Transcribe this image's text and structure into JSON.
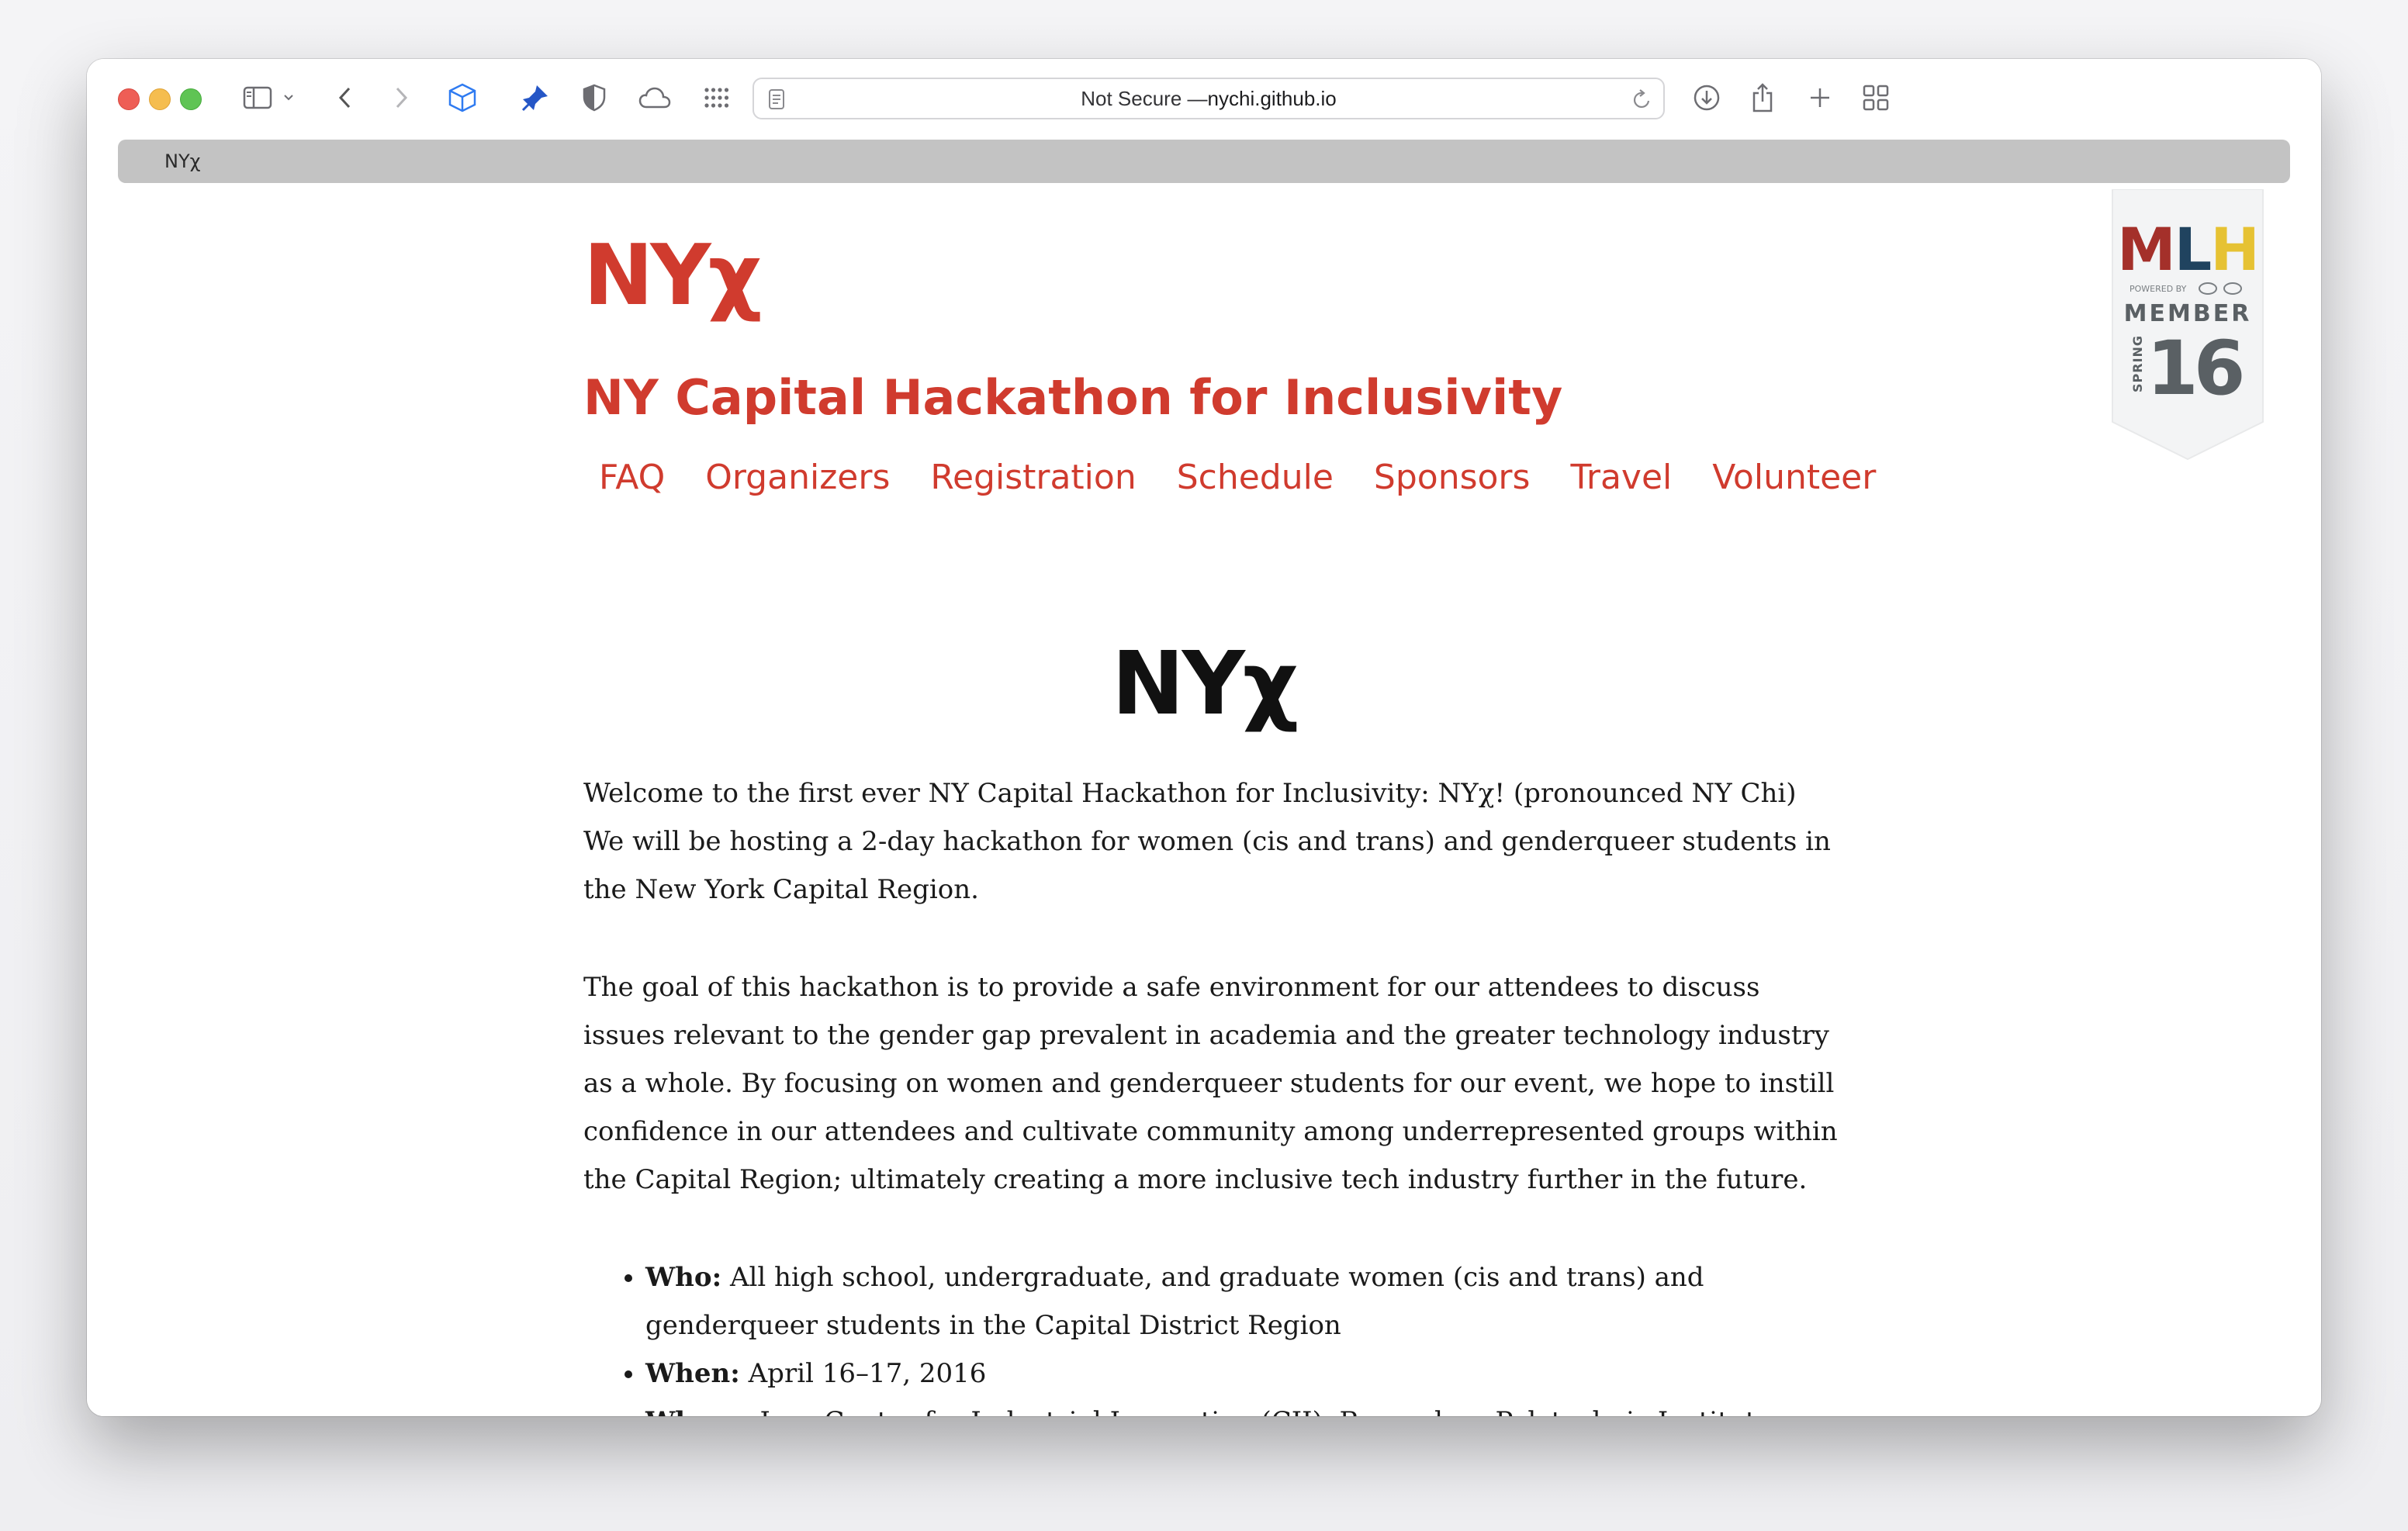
{
  "browser": {
    "address_prefix": "Not Secure — ",
    "address_host": "nychi.github.io",
    "tab_title": "NYχ"
  },
  "site": {
    "logo": "NYχ",
    "tagline": "NY Capital Hackathon for Inclusivity",
    "nav": [
      "FAQ",
      "Organizers",
      "Registration",
      "Schedule",
      "Sponsors",
      "Travel",
      "Volunteer"
    ],
    "badge": {
      "brand": "MLH",
      "powered_by": "POWERED BY",
      "member": "MEMBER",
      "season": "SPRING",
      "year": "16"
    }
  },
  "main": {
    "title": "NYχ",
    "paragraphs": [
      "Welcome to the first ever NY Capital Hackathon for Inclusivity: NYχ! (pronounced NY Chi) We will be hosting a 2-day hackathon for women (cis and trans) and genderqueer students in the New York Capital Region.",
      "The goal of this hackathon is to provide a safe environment for our attendees to discuss issues relevant to the gender gap prevalent in academia and the greater technology industry as a whole. By focusing on women and genderqueer students for our event, we hope to instill confidence in our attendees and cultivate community among underrepresented groups within the Capital Region; ultimately creating a more inclusive tech industry further in the future."
    ],
    "facts": [
      {
        "label": "Who:",
        "text": " All high school, undergraduate, and graduate women (cis and trans) and genderqueer students in the Capital District Region"
      },
      {
        "label": "When:",
        "text": " April 16–17, 2016"
      },
      {
        "label": "Where:",
        "text": " Low Center for Industrial Innovation (CII), Rensselaer Polytechnic Institute, Troy, NY"
      }
    ]
  },
  "colors": {
    "brand_red": "#d03b2e",
    "mlh_red": "#a4302a",
    "mlh_blue": "#20435f",
    "mlh_yellow": "#e6c233",
    "badge_gray": "#5a6064"
  }
}
